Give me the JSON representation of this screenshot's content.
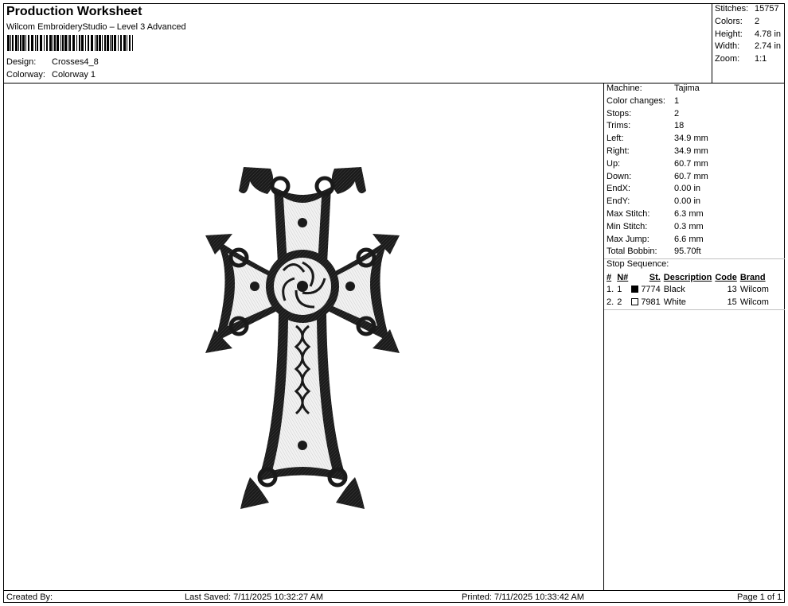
{
  "header": {
    "title": "Production Worksheet",
    "subtitle": "Wilcom EmbroideryStudio – Level 3 Advanced",
    "design_label": "Design:",
    "design_value": "Crosses4_8",
    "colorway_label": "Colorway:",
    "colorway_value": "Colorway 1"
  },
  "summary": [
    {
      "label": "Stitches:",
      "value": "15757"
    },
    {
      "label": "Colors:",
      "value": "2"
    },
    {
      "label": "Height:",
      "value": "4.78 in"
    },
    {
      "label": "Width:",
      "value": "2.74 in"
    },
    {
      "label": "Zoom:",
      "value": "1:1"
    }
  ],
  "stats": [
    {
      "label": "Machine:",
      "value": "Tajima"
    },
    {
      "label": "Color changes:",
      "value": "1"
    },
    {
      "label": "Stops:",
      "value": "2"
    },
    {
      "label": "Trims:",
      "value": "18"
    },
    {
      "label": "Left:",
      "value": "34.9 mm"
    },
    {
      "label": "Right:",
      "value": "34.9 mm"
    },
    {
      "label": "Up:",
      "value": "60.7 mm"
    },
    {
      "label": "Down:",
      "value": "60.7 mm"
    },
    {
      "label": "EndX:",
      "value": "0.00 in"
    },
    {
      "label": "EndY:",
      "value": "0.00 in"
    },
    {
      "label": "Max Stitch:",
      "value": "6.3 mm"
    },
    {
      "label": "Min Stitch:",
      "value": "0.3 mm"
    },
    {
      "label": "Max Jump:",
      "value": "6.6 mm"
    },
    {
      "label": "Total Bobbin:",
      "value": "95.70ft"
    }
  ],
  "stop_sequence": {
    "title": "Stop Sequence:",
    "headers": {
      "num": "#",
      "n": "N#",
      "st": "St.",
      "desc": "Description",
      "code": "Code",
      "brand": "Brand"
    },
    "rows": [
      {
        "num": "1.",
        "n": "1",
        "color": "#000000",
        "st": "7774",
        "desc": "Black",
        "code": "13",
        "brand": "Wilcom"
      },
      {
        "num": "2.",
        "n": "2",
        "color": "#ffffff",
        "st": "7981",
        "desc": "White",
        "code": "15",
        "brand": "Wilcom"
      }
    ]
  },
  "footer": {
    "created_by": "Created By:",
    "last_saved": "Last Saved: 7/11/2025 10:32:27 AM",
    "printed": "Printed: 7/11/2025 10:33:42 AM",
    "page": "Page 1 of 1"
  }
}
